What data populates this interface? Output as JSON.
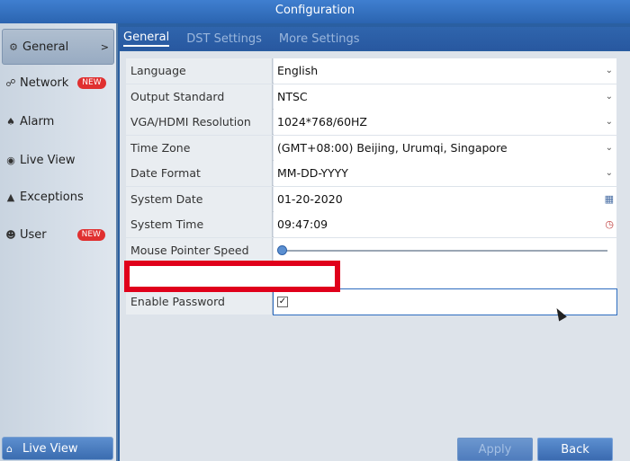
{
  "window": {
    "title": "Configuration"
  },
  "sidebar": {
    "items": [
      {
        "label": "General",
        "icon": "gear-icon",
        "active": true
      },
      {
        "label": "Network",
        "icon": "network-icon",
        "badge": "NEW"
      },
      {
        "label": "Alarm",
        "icon": "bell-icon"
      },
      {
        "label": "Live View",
        "icon": "eye-icon"
      },
      {
        "label": "Exceptions",
        "icon": "warning-icon"
      },
      {
        "label": "User",
        "icon": "users-icon",
        "badge": "NEW"
      }
    ],
    "bottom": {
      "label": "Live View",
      "icon": "home-icon"
    }
  },
  "tabs": [
    {
      "label": "General",
      "active": true
    },
    {
      "label": "DST Settings"
    },
    {
      "label": "More Settings"
    }
  ],
  "settings": [
    {
      "label": "Language",
      "value": "English",
      "control": "dropdown"
    },
    {
      "label": "Output Standard",
      "value": "NTSC",
      "control": "dropdown"
    },
    {
      "label": "VGA/HDMI Resolution",
      "value": "1024*768/60HZ",
      "control": "dropdown"
    },
    {
      "label": "Time Zone",
      "value": "(GMT+08:00) Beijing, Urumqi, Singapore",
      "control": "dropdown"
    },
    {
      "label": "Date Format",
      "value": "MM-DD-YYYY",
      "control": "dropdown"
    },
    {
      "label": "System Date",
      "value": "01-20-2020",
      "control": "date"
    },
    {
      "label": "System Time",
      "value": "09:47:09",
      "control": "time"
    },
    {
      "label": "Mouse Pointer Speed",
      "value": "",
      "control": "slider",
      "level": 0
    },
    {
      "label": "",
      "value": "",
      "control": "redacted"
    },
    {
      "label": "Enable Password",
      "value": "",
      "control": "checkbox",
      "checked": true
    }
  ],
  "buttons": {
    "apply": "Apply",
    "back": "Back"
  },
  "colors": {
    "accent": "#2b64b0",
    "badge": "#e03030",
    "redaction": "#e0001b"
  }
}
